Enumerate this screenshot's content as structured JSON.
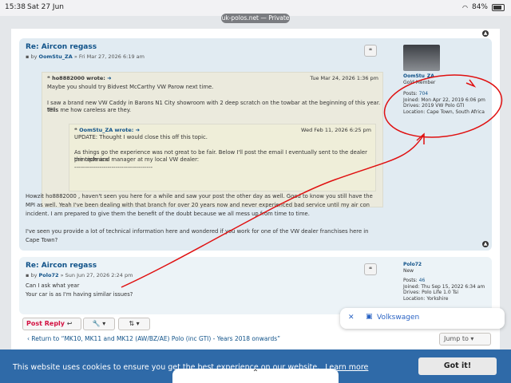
{
  "status": {
    "time": "15:38",
    "date": "Sat 27 Jun",
    "url": "uk-polos.net — Private",
    "battery": "84%"
  },
  "post1": {
    "title": "Re: Aircon regass",
    "by": "by",
    "author": "OomStu_ZA",
    "date": "» Fri Mar 27, 2026 6:19 am",
    "quote1": {
      "head": "ho8882000 wrote:",
      "date": "Tue Mar 24, 2026 1:36 pm",
      "line1": "Maybe you should try Bidvest McCarthy VW Parow next time.",
      "line2": "I saw a brand new VW Caddy in Barons N1 City showroom with 2 deep scratch on the towbar at the beginning of this year. This",
      "line3": "tells me how careless are they."
    },
    "quote2": {
      "head": "OomStu_ZA wrote:",
      "date": "Wed Feb 11, 2026 6:25 pm",
      "line1": "UPDATE: Thought I would close this off this topic.",
      "line2": "As things go the experience was not great to be fair. Below I'll post the email I eventually sent to the dealer principle and",
      "line3": "the technical manager at my local VW dealer:",
      "line4": "----------------------------------------"
    },
    "body1": "Howzit ho8882000 , haven't seen you here for a while and saw your post the other day as well. Good to know you still have the",
    "body2": "MPI as well. Yeah I've been dealing with that branch for over 20 years now and never experienced bad service until my air con",
    "body3": "incident. I am prepared to give them the benefit of the doubt because we all mess up from time to time.",
    "body4": "I've seen you provide a lot of technical information here and wondered if you work for one of the VW dealer franchises here in",
    "body5": "Cape Town?",
    "profile": {
      "name": "OomStu_ZA",
      "rank": "Gold Member",
      "posts_label": "Posts:",
      "posts": "704",
      "joined_label": "Joined:",
      "joined": "Mon Apr 22, 2019 6:06 pm",
      "drives_label": "Drives:",
      "drives": "2019 VW Polo GTI",
      "location_label": "Location:",
      "location": "Cape Town, South Africa"
    }
  },
  "post2": {
    "title": "Re: Aircon regass",
    "by": "by",
    "author": "Polo72",
    "date": "» Sun Jun 27, 2026 2:24 pm",
    "body1": "Can I ask what year",
    "body2": "Your car is as I'm having similar issues?",
    "profile": {
      "name": "Polo72",
      "rank": "New",
      "posts_label": "Posts:",
      "posts": "46",
      "joined_label": "Joined:",
      "joined": "Thu Sep 15, 2022 6:34 am",
      "drives_label": "Drives:",
      "drives": "Polo Life 1.0 Tsi",
      "location_label": "Location:",
      "location": "Yorkshire"
    }
  },
  "actions": {
    "post_reply": "Post Reply",
    "return": "Return to “MK10, MK11 and MK12 (AW/BZ/AE) Polo (inc GTI) - Years 2018 onwards”",
    "jump": "Jump to"
  },
  "popup": {
    "label": "Volkswagen"
  },
  "cookie": {
    "message": "This website uses cookies to ensure you get the best experience on our website.",
    "learn": "Learn more",
    "button": "Got it!"
  },
  "icons": {
    "quote": "❝",
    "up": "⌃",
    "wrench": "🔧",
    "sort": "⇅",
    "close": "✕"
  }
}
